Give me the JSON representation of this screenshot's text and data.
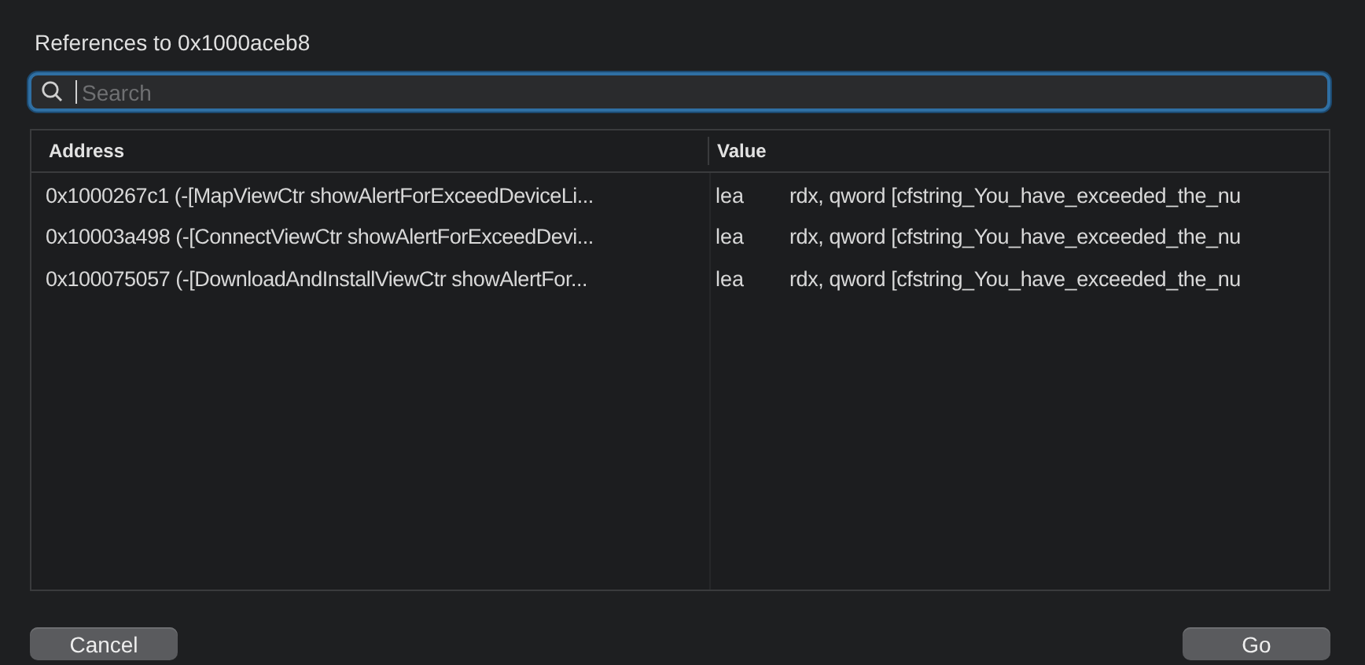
{
  "window": {
    "title": "References to 0x1000aceb8"
  },
  "search": {
    "placeholder": "Search",
    "focused": true
  },
  "table": {
    "columns": [
      "Address",
      "Value"
    ],
    "rows": [
      {
        "address": "0x1000267c1 (-[MapViewCtr showAlertForExceedDeviceLi...",
        "mnemonic": "lea",
        "operands": "rdx, qword [cfstring_You_have_exceeded_the_nu"
      },
      {
        "address": "0x10003a498 (-[ConnectViewCtr showAlertForExceedDevi...",
        "mnemonic": "lea",
        "operands": "rdx, qword [cfstring_You_have_exceeded_the_nu"
      },
      {
        "address": "0x100075057 (-[DownloadAndInstallViewCtr showAlertFor...",
        "mnemonic": "lea",
        "operands": "rdx, qword [cfstring_You_have_exceeded_the_nu"
      }
    ]
  },
  "buttons": [
    {
      "label": "Cancel"
    },
    {
      "label": "Go"
    }
  ]
}
